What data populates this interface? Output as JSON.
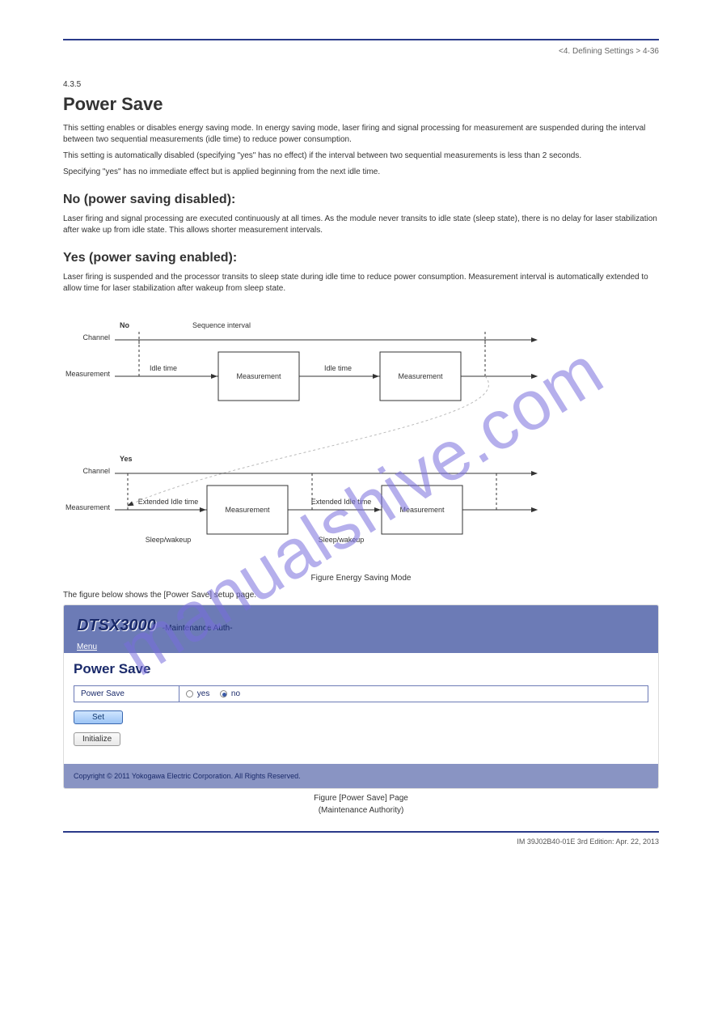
{
  "page": {
    "top_right": "<4. Defining Settings > 4-36",
    "section_pre": "4.3.5",
    "title": "Power Save",
    "p1": "This setting enables or disables energy saving mode. In energy saving mode, laser firing and signal processing for measurement are suspended during the interval between two sequential measurements (idle time) to reduce power consumption.",
    "p2": "This setting is automatically disabled (specifying \"yes\" has no effect) if the interval between two sequential measurements is less than 2 seconds.",
    "p3": "Specifying \"yes\" has no immediate effect but is applied beginning from the next idle time.",
    "h2": "No (power saving disabled):",
    "p4": "Laser firing and signal processing are executed continuously at all times. As the module never transits to idle state (sleep state), there is no delay for laser stabilization after wake up from idle state. This allows shorter measurement intervals.",
    "h3": "Yes (power saving enabled):",
    "p5": "Laser firing is suspended and the processor transits to sleep state during idle time to reduce power consumption. Measurement interval is automatically extended to allow time for laser stabilization after wakeup from sleep state.",
    "caption1": "Figure Energy Saving Mode",
    "ss_intro": "The figure below shows the [Power Save] setup page.",
    "caption2": "Figure [Power Save] Page",
    "caption2_sub": "(Maintenance Authority)",
    "bottom": "IM 39J02B40-01E   3rd Edition: Apr. 22, 2013"
  },
  "diagram": {
    "no_label": "No",
    "yes_label": "Yes",
    "seq_interval": "Sequence interval",
    "channel_top": "Channel",
    "meas_top": "Measurement",
    "idle_left": "Idle time",
    "meas_box": "Measurement",
    "idle_mid": "Idle time",
    "ext_idle": "Extended Idle time",
    "ext_idle2": "Extended Idle time",
    "sleep_wake": "Sleep/wakeup",
    "sleep_wake2": "Sleep/wakeup"
  },
  "screenshot": {
    "app_title": "DTSX3000",
    "app_sub": "-Maintenance Auth-",
    "menu": "Menu",
    "page_h": "Power Save",
    "row_label": "Power Save",
    "opt_yes": "yes",
    "opt_no": "no",
    "btn_set": "Set",
    "btn_init": "Initialize",
    "copyright": "Copyright © 2011 Yokogawa Electric Corporation. All Rights Reserved."
  },
  "watermark": "manualshive.com"
}
